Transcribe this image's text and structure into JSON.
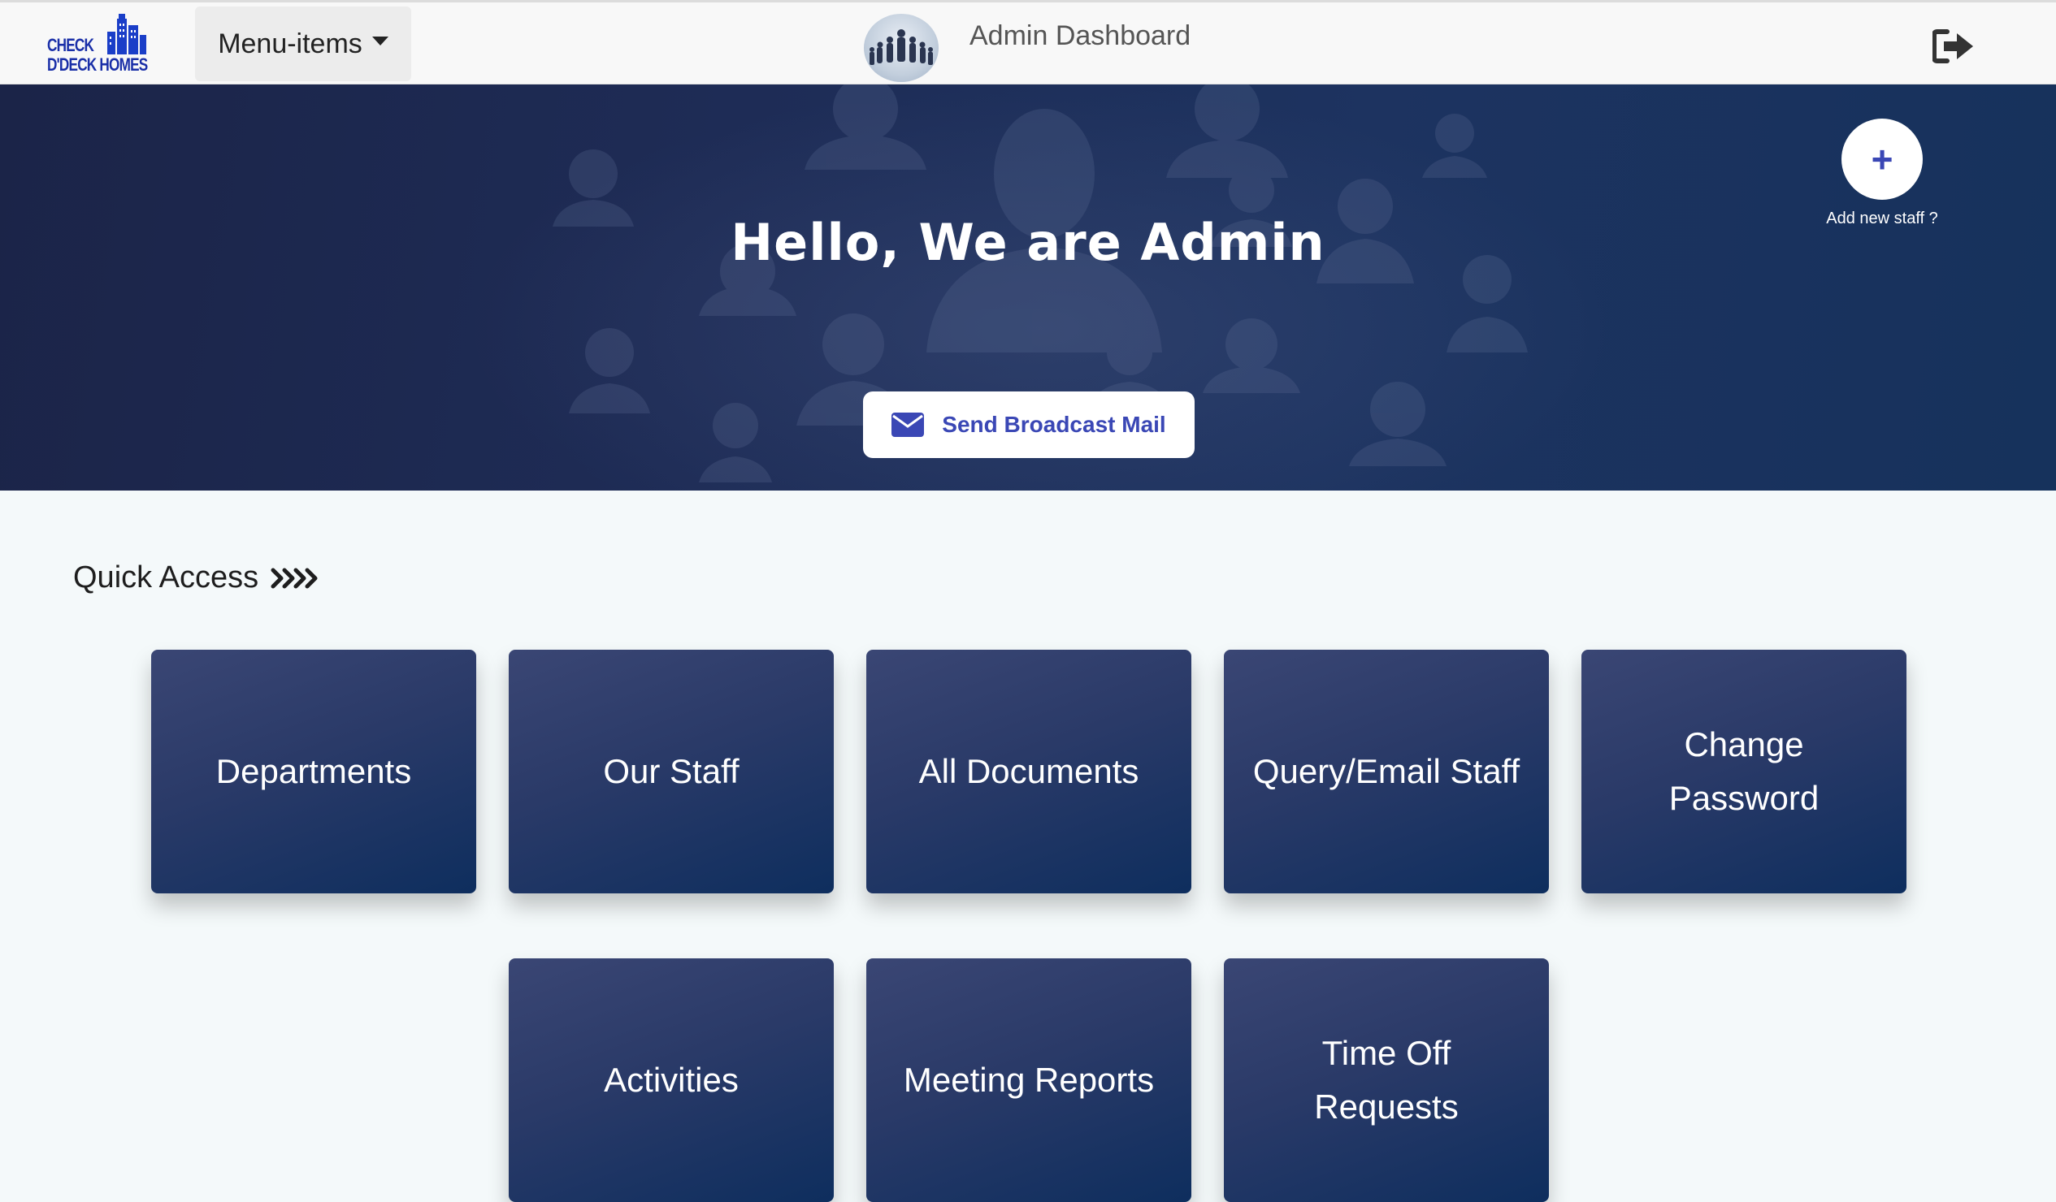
{
  "navbar": {
    "logo_line1": "CHECK",
    "logo_line2": "D'DECK HOMES",
    "menu_label": "Menu-items",
    "title": "Admin Dashboard",
    "logout_icon": "sign-out-icon"
  },
  "hero": {
    "title": "Hello, We are Admin",
    "broadcast_label": "Send Broadcast Mail",
    "broadcast_icon": "envelope-icon",
    "add_icon": "plus-icon",
    "add_label": "Add new staff ?"
  },
  "quick_access": {
    "heading": "Quick Access",
    "tiles": [
      {
        "label": "Departments"
      },
      {
        "label": "Our Staff"
      },
      {
        "label": "All Documents"
      },
      {
        "label": "Query/Email Staff"
      },
      {
        "label": "Change Password"
      },
      {
        "label": "Activities"
      },
      {
        "label": "Meeting Reports"
      },
      {
        "label": "Time Off Requests"
      }
    ]
  },
  "colors": {
    "hero_bg": "#1e2c56",
    "tile_bg": "#2a3a68",
    "accent": "#3a47b5",
    "logo_blue": "#1a2fa8"
  }
}
